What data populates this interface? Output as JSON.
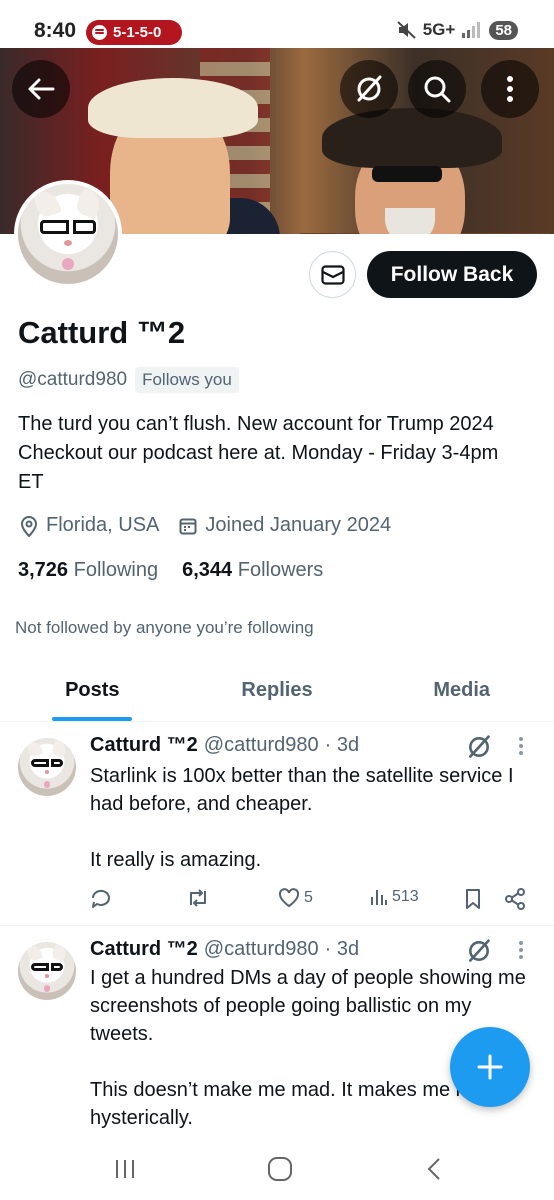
{
  "status_bar": {
    "time": "8:40",
    "spotify_pill": "5-1-5-0",
    "network": "5G+",
    "battery": "58"
  },
  "profile": {
    "display_name": "Catturd ™2",
    "handle": "@catturd980",
    "follows_you": "Follows you",
    "follow_button": "Follow Back",
    "bio": "The turd you can’t flush. New account for Trump 2024 Checkout our podcast here at. Monday - Friday 3-4pm ET",
    "location": "Florida, USA",
    "joined": "Joined January 2024",
    "following_count": "3,726",
    "following_label": "Following",
    "followers_count": "6,344",
    "followers_label": "Followers",
    "not_followed": "Not followed by anyone you’re following"
  },
  "tabs": [
    {
      "label": "Posts",
      "active": true
    },
    {
      "label": "Replies",
      "active": false
    },
    {
      "label": "Media",
      "active": false
    }
  ],
  "posts": [
    {
      "name": "Catturd ™2",
      "handle": "@catturd980",
      "time": "· 3d",
      "text": "Starlink is 100x better than the satellite service I had before, and cheaper.\n\nIt really is amazing.",
      "likes": "5",
      "views": "513"
    },
    {
      "name": "Catturd ™2",
      "handle": "@catturd980",
      "time": "· 3d",
      "text": "I get a hundred DMs a day of people showing me screenshots of people going ballistic on my tweets.\n\nThis doesn’t make me mad. It makes me laugh hysterically."
    }
  ],
  "colors": {
    "accent": "#1d9bf0",
    "text_primary": "#0f1419",
    "text_secondary": "#536471",
    "spotify_pill": "#b3161f"
  }
}
